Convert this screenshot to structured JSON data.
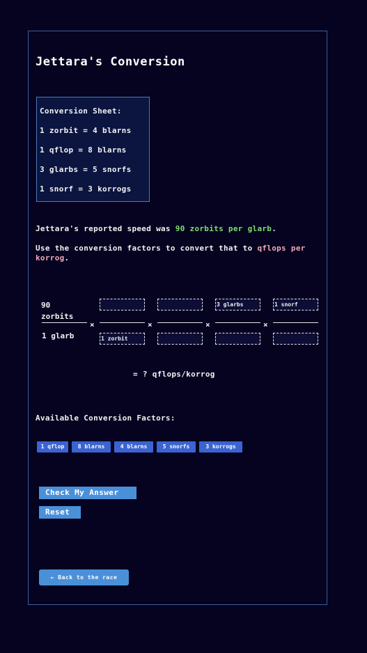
{
  "page": {
    "title": "Jettara's Conversion"
  },
  "sheet": {
    "heading": "Conversion Sheet:",
    "lines": [
      "1 zorbit = 4 blarns",
      "1 qflop = 8 blarns",
      "3 glarbs = 5 snorfs",
      "1 snorf = 3 korrogs"
    ]
  },
  "prompt": {
    "speed_prefix": "Jettara's reported speed was ",
    "speed_value": "90 zorbits per glarb",
    "speed_suffix": ".",
    "instruction_prefix": "Use the conversion factors to convert that to ",
    "instruction_target": "qflops per korrog",
    "instruction_suffix": "."
  },
  "equation": {
    "start_numerator": "90 zorbits",
    "start_denominator": "1 glarb",
    "times_symbol": "×",
    "slots": [
      {
        "numerator": "",
        "denominator": "1 zorbit"
      },
      {
        "numerator": "",
        "denominator": ""
      },
      {
        "numerator": "3 glarbs",
        "denominator": ""
      },
      {
        "numerator": "1 snorf",
        "denominator": ""
      }
    ],
    "result": "= ? qflops/korrog"
  },
  "factors": {
    "title": "Available Conversion Factors:",
    "chips": [
      "1 qflop",
      "8 blarns",
      "4 blarns",
      "5 snorfs",
      "3 korrogs"
    ]
  },
  "buttons": {
    "check": "Check My Answer",
    "reset": "Reset",
    "back": "← Back to the race"
  },
  "colors": {
    "background": "#05031f",
    "accent_green": "#7ddf6e",
    "accent_pink": "#f3a7b6",
    "chip_blue": "#3b63d1",
    "button_blue": "#4a90d9"
  }
}
